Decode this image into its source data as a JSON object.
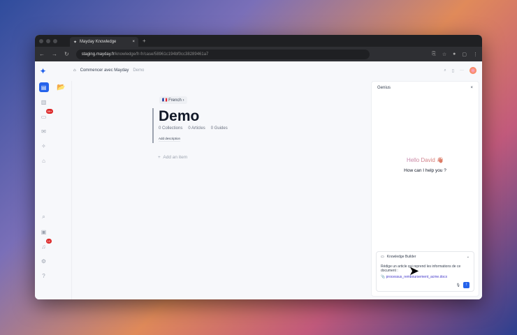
{
  "browser": {
    "tab_title": "Mayday Knowledge",
    "url_host": "staging.mayday.fr",
    "url_path": "/knowledge/fr-fr/case/58961c194bf0cc38289461a7"
  },
  "sidebar": {
    "badges": {
      "inbox": "99+",
      "notifications": "12"
    }
  },
  "breadcrumb": {
    "root": "Commencer avec Mayday",
    "current": "Demo"
  },
  "main": {
    "language": "French",
    "title": "Demo",
    "collections": "0 Collections",
    "articles": "0 Articles",
    "guides": "0 Guides",
    "add_description": "Add description",
    "add_item": "Add an item"
  },
  "genius": {
    "title": "Genius",
    "hello": "Hello David 👋",
    "help": "How can I help you ?",
    "builder": "Knowledge Builder",
    "prompt": "Rédige un article qui reprend les informations de ce document :",
    "file": "processus_remboursement_acme.docx"
  },
  "colors": {
    "accent": "#2563eb",
    "badge": "#dc2626"
  }
}
